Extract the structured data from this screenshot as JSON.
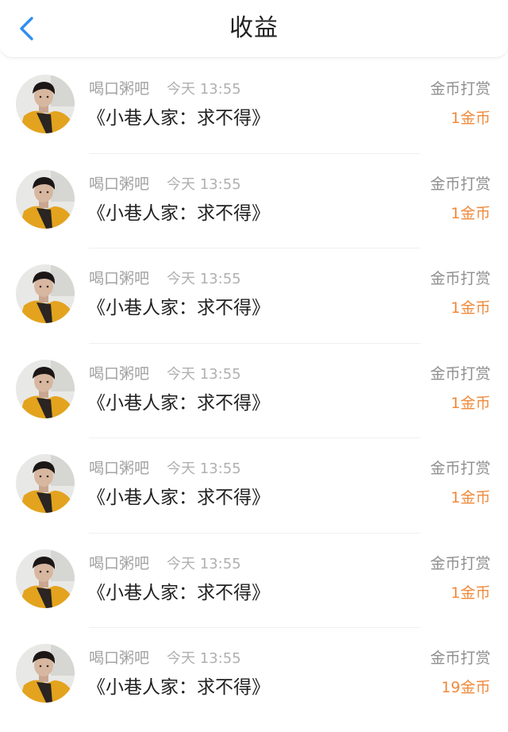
{
  "header": {
    "title": "收益",
    "back_icon": "chevron-left-icon",
    "accent": "#2f8ff0"
  },
  "rewards": [
    {
      "user": "喝口粥吧",
      "time": "今天 13:55",
      "work": "《小巷人家：求不得》",
      "type": "金币打赏",
      "amount": "1金币"
    },
    {
      "user": "喝口粥吧",
      "time": "今天 13:55",
      "work": "《小巷人家：求不得》",
      "type": "金币打赏",
      "amount": "1金币"
    },
    {
      "user": "喝口粥吧",
      "time": "今天 13:55",
      "work": "《小巷人家：求不得》",
      "type": "金币打赏",
      "amount": "1金币"
    },
    {
      "user": "喝口粥吧",
      "time": "今天 13:55",
      "work": "《小巷人家：求不得》",
      "type": "金币打赏",
      "amount": "1金币"
    },
    {
      "user": "喝口粥吧",
      "time": "今天 13:55",
      "work": "《小巷人家：求不得》",
      "type": "金币打赏",
      "amount": "1金币"
    },
    {
      "user": "喝口粥吧",
      "time": "今天 13:55",
      "work": "《小巷人家：求不得》",
      "type": "金币打赏",
      "amount": "1金币"
    },
    {
      "user": "喝口粥吧",
      "time": "今天 13:55",
      "work": "《小巷人家：求不得》",
      "type": "金币打赏",
      "amount": "19金币"
    }
  ],
  "colors": {
    "amount": "#ef8a3c",
    "muted": "#a2a2a2",
    "text": "#222222"
  }
}
